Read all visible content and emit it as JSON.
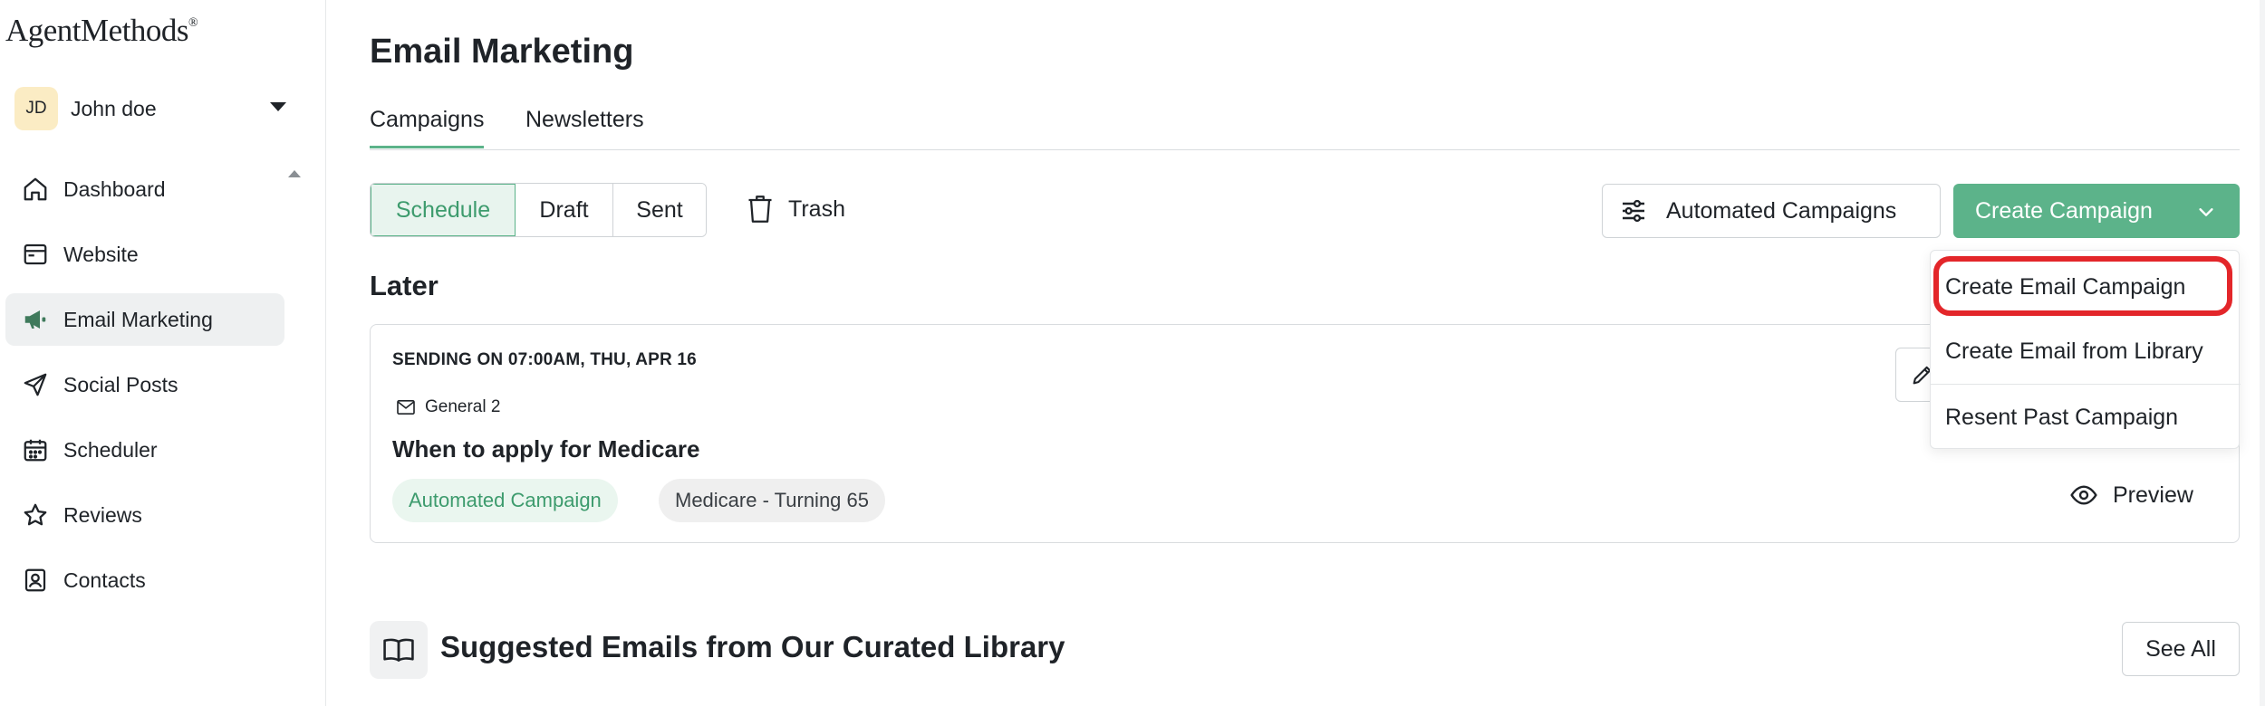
{
  "brand": {
    "logo_text": "AgentMethods",
    "logo_mark": "®"
  },
  "user": {
    "initials": "JD",
    "name": "John doe"
  },
  "sidebar": {
    "items": [
      {
        "label": "Dashboard",
        "icon": "home-icon"
      },
      {
        "label": "Website",
        "icon": "browser-icon"
      },
      {
        "label": "Email Marketing",
        "icon": "megaphone-icon",
        "active": true
      },
      {
        "label": "Social Posts",
        "icon": "send-icon"
      },
      {
        "label": "Scheduler",
        "icon": "calendar-icon"
      },
      {
        "label": "Reviews",
        "icon": "star-icon"
      },
      {
        "label": "Contacts",
        "icon": "contact-icon"
      }
    ]
  },
  "page": {
    "title": "Email Marketing"
  },
  "tabs": [
    {
      "label": "Campaigns",
      "active": true
    },
    {
      "label": "Newsletters"
    }
  ],
  "filters": {
    "segments": [
      "Schedule",
      "Draft",
      "Sent"
    ],
    "active_segment": "Schedule",
    "trash_label": "Trash"
  },
  "actions": {
    "automated_label": "Automated Campaigns",
    "create_label": "Create Campaign"
  },
  "dropdown": {
    "items": [
      "Create Email Campaign",
      "Create Email from Library",
      "Resent Past Campaign"
    ],
    "highlighted": "Create Email Campaign"
  },
  "later": {
    "heading": "Later",
    "campaign": {
      "sending": "SENDING ON 07:00AM, THU, APR 16",
      "list": "General 2",
      "title": "When to apply for Medicare",
      "tags": [
        "Automated Campaign",
        "Medicare - Turning 65"
      ],
      "preview_label": "Preview"
    }
  },
  "library": {
    "title": "Suggested Emails from Our Curated Library",
    "see_all_label": "See All"
  },
  "colors": {
    "accent": "#5cb38a",
    "highlight": "#e3262a",
    "avatar_bg": "#fbecc4"
  }
}
